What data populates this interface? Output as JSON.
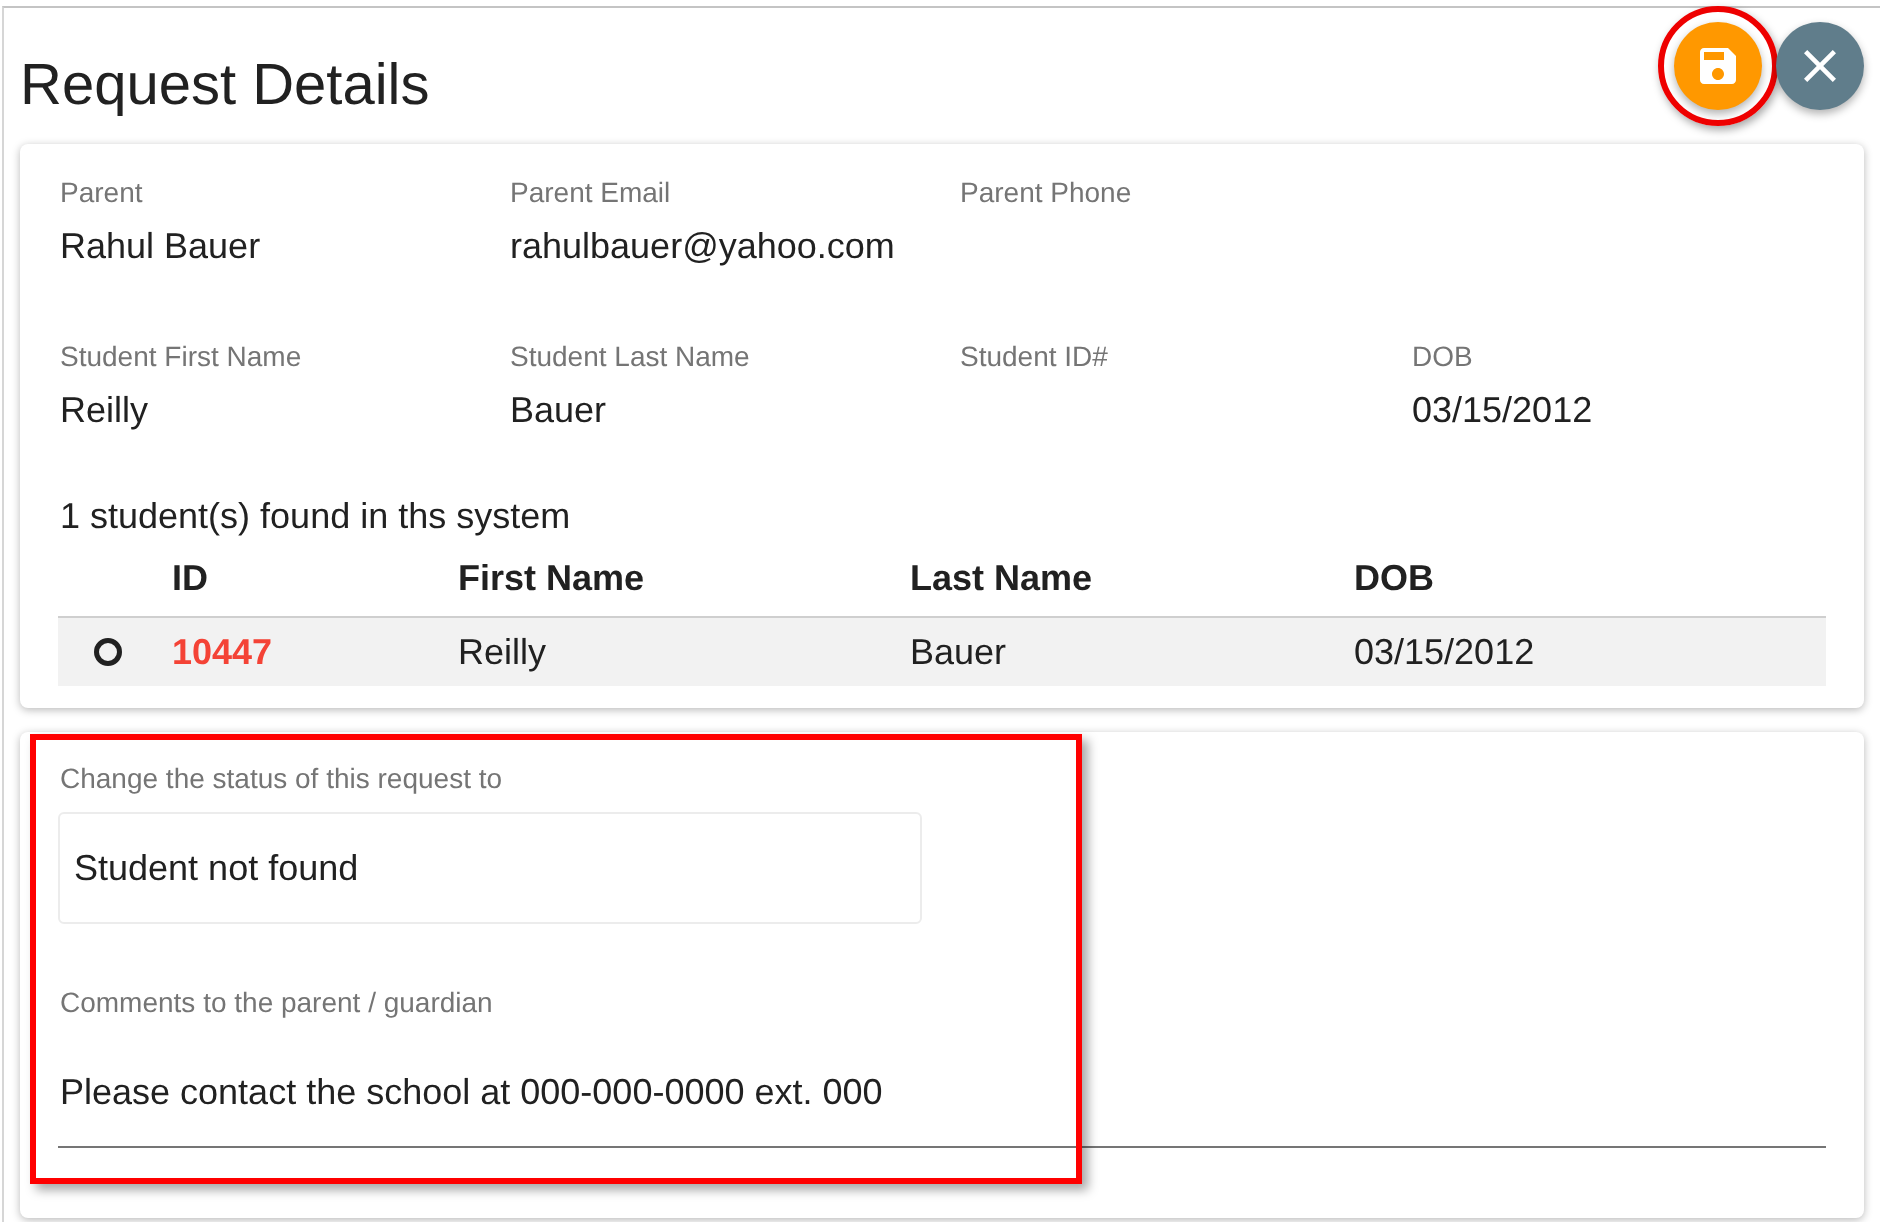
{
  "header": {
    "title": "Request Details",
    "actions": [
      {
        "kind": "save",
        "highlighted": true
      },
      {
        "kind": "close",
        "highlighted": false
      }
    ]
  },
  "details": {
    "rows": [
      [
        {
          "label": "Parent",
          "value": "Rahul Bauer"
        },
        {
          "label": "Parent Email",
          "value": "rahulbauer@yahoo.com"
        },
        {
          "label": "Parent Phone"
        }
      ],
      [
        {
          "label": "Student First Name",
          "value": "Reilly"
        },
        {
          "label": "Student Last Name",
          "value": "Bauer"
        },
        {
          "label": "Student ID#"
        },
        {
          "label": "DOB",
          "value": "03/15/2012"
        }
      ]
    ]
  },
  "matches": {
    "summary": "1 student(s) found in ths system",
    "columns": [
      "ID",
      "First Name",
      "Last Name",
      "DOB"
    ],
    "rows": [
      {
        "selected": false,
        "cells": [
          "10447",
          "Reilly",
          "Bauer",
          "03/15/2012"
        ]
      }
    ]
  },
  "status_form": {
    "highlighted": true,
    "status": {
      "label": "Change the status of this request to",
      "value": "Student not found"
    },
    "comments": {
      "label": "Comments to the parent / guardian",
      "value": "Please contact the school at 000-000-0000 ext. 000"
    }
  }
}
